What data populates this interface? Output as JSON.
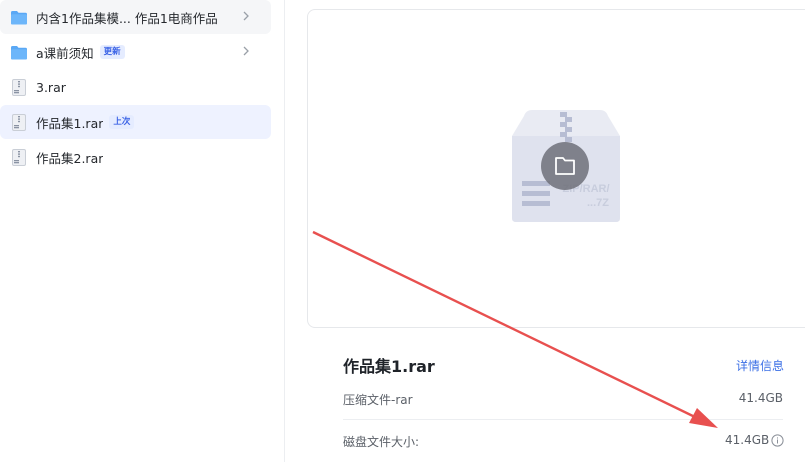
{
  "file_list": [
    {
      "name": "内含1作品集模... 作品1电商作品",
      "icon": "folder-icon",
      "badge": "",
      "has_chevron": true
    },
    {
      "name": "a课前须知",
      "icon": "folder-icon",
      "badge": "更新",
      "has_chevron": true
    },
    {
      "name": "3.rar",
      "icon": "archive-file-icon",
      "badge": "",
      "has_chevron": false
    },
    {
      "name": "作品集1.rar",
      "icon": "archive-file-icon",
      "badge": "上次",
      "has_chevron": false
    },
    {
      "name": "作品集2.rar",
      "icon": "archive-file-icon",
      "badge": "",
      "has_chevron": false
    }
  ],
  "preview": {
    "art_text_line1": "ZIP/RAR/",
    "art_text_line2": "...7Z",
    "file_title": "作品集1.rar",
    "detail_link": "详情信息",
    "type_label": "压缩文件-rar",
    "type_size": "41.4GB",
    "disk_label": "磁盘文件大小:",
    "disk_size": "41.4GB"
  },
  "colors": {
    "accent": "#3b6fe6",
    "selected_row": "#eef2ff",
    "folder": "#5aa8f5",
    "arrow": "#e8504f"
  }
}
